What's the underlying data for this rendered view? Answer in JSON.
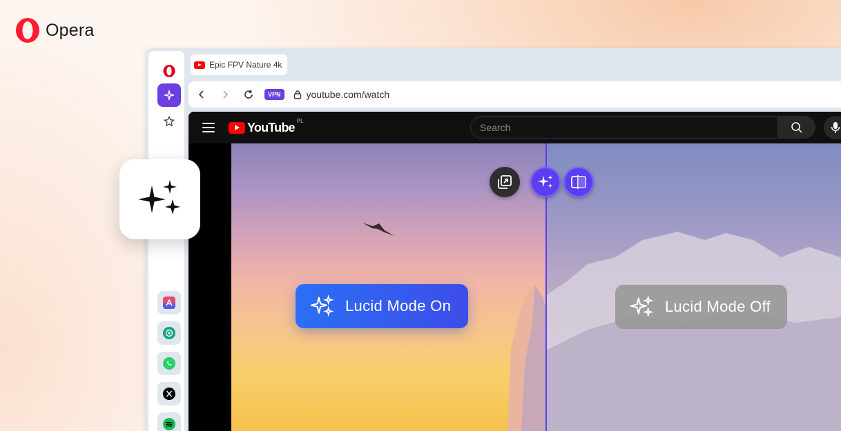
{
  "brand": {
    "name": "Opera",
    "logo_icon": "opera-logo-icon",
    "color": "#ff1b2d"
  },
  "browser": {
    "tab": {
      "title": "Epic FPV Nature 4k",
      "favicon": "youtube-favicon-icon"
    },
    "address_bar": {
      "vpn_badge": "VPN",
      "url": "youtube.com/watch"
    },
    "sidebar": {
      "items": [
        {
          "name": "opera-logo-icon"
        },
        {
          "name": "aria-sparkle-icon",
          "active": true,
          "active_color": "#6b3fe0"
        },
        {
          "name": "star-icon"
        }
      ],
      "apps": [
        {
          "name": "app-store-icon"
        },
        {
          "name": "chatgpt-icon"
        },
        {
          "name": "whatsapp-icon"
        },
        {
          "name": "x-icon"
        },
        {
          "name": "spotify-icon"
        }
      ]
    }
  },
  "youtube": {
    "logo_text": "YouTube",
    "region": "PL",
    "search_placeholder": "Search"
  },
  "lucid": {
    "on_label": "Lucid Mode On",
    "off_label": "Lucid Mode Off",
    "on_color": "#2b6ff5",
    "divider_color": "#5b3ef0"
  }
}
